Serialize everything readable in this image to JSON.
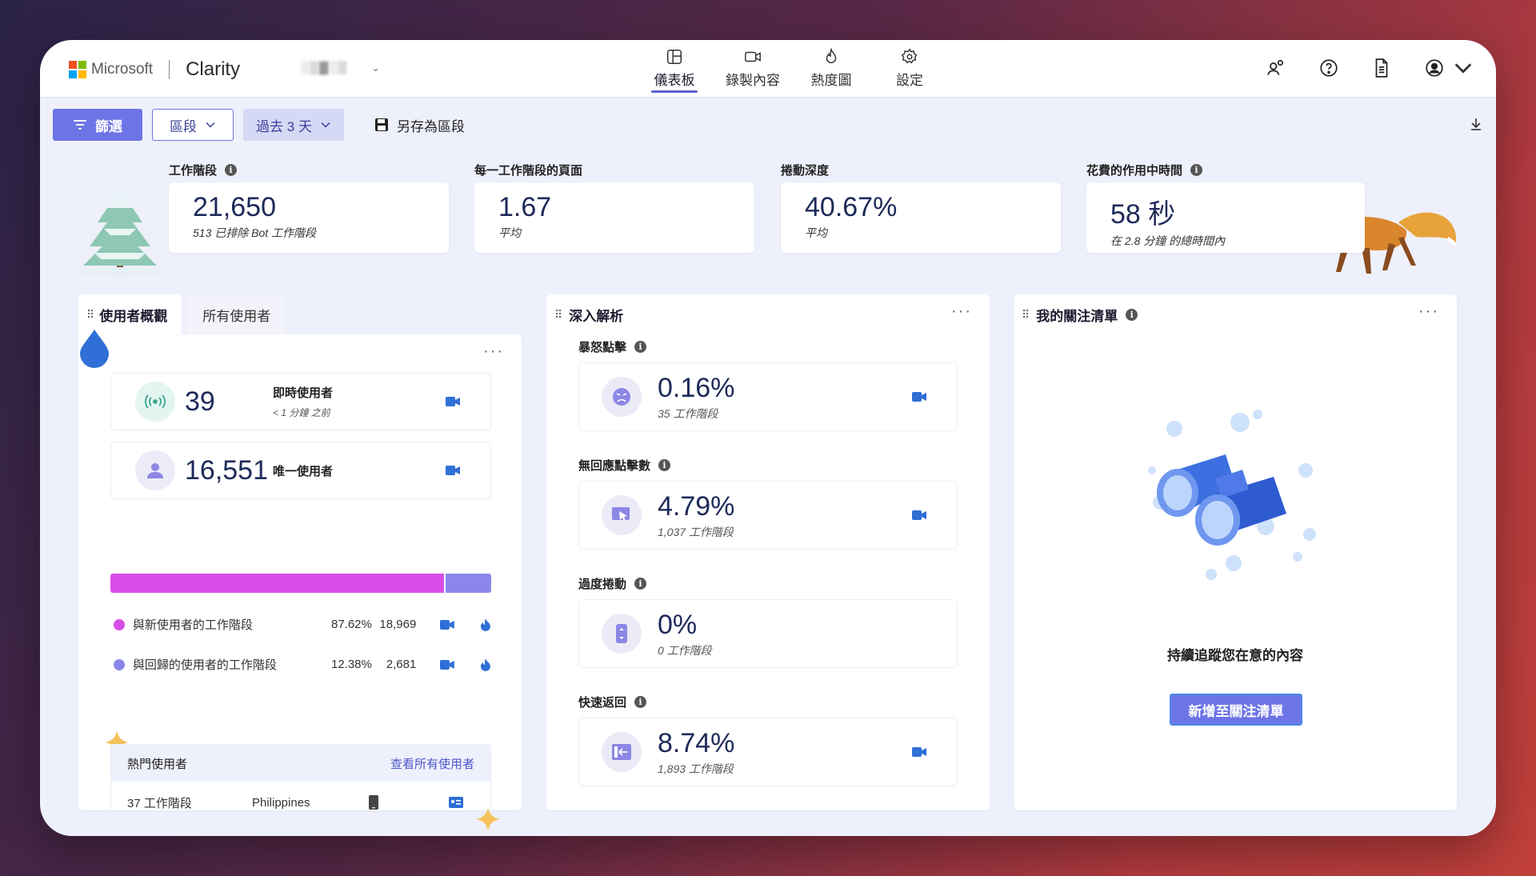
{
  "brand": {
    "company": "Microsoft",
    "app": "Clarity",
    "project": "░▒▓░▒"
  },
  "nav": {
    "tabs": [
      {
        "label": "儀表板",
        "icon": "dashboard-icon",
        "active": true
      },
      {
        "label": "錄製內容",
        "icon": "recordings-icon",
        "active": false
      },
      {
        "label": "熱度圖",
        "icon": "heatmaps-icon",
        "active": false
      },
      {
        "label": "設定",
        "icon": "settings-icon",
        "active": false
      }
    ]
  },
  "filterbar": {
    "filter_label": "篩選",
    "segment_label": "區段",
    "range_label": "過去 3 天",
    "save_label": "另存為區段"
  },
  "kpis": [
    {
      "label": "工作階段",
      "value": "21,650",
      "sub": "513 已排除 Bot 工作階段",
      "info": true
    },
    {
      "label": "每一工作階段的頁面",
      "value": "1.67",
      "sub": "平均",
      "info": false
    },
    {
      "label": "捲動深度",
      "value": "40.67%",
      "sub": "平均",
      "info": false
    },
    {
      "label": "花費的作用中時間",
      "value": "58 秒",
      "sub": "在 2.8 分鐘 的總時間內",
      "info": true
    }
  ],
  "users_panel": {
    "tabs": [
      "使用者概觀",
      "所有使用者"
    ],
    "live": {
      "value": "39",
      "label": "即時使用者",
      "sub": "< 1 分鐘 之前"
    },
    "unique": {
      "value": "16,551",
      "label": "唯一使用者"
    },
    "split": {
      "new_fraction": 0.8762,
      "colors": {
        "new": "#d84de8",
        "returning": "#8b87ea"
      },
      "rows": [
        {
          "label": "與新使用者的工作階段",
          "pct": "87.62%",
          "count": "18,969"
        },
        {
          "label": "與回歸的使用者的工作階段",
          "pct": "12.38%",
          "count": "2,681"
        }
      ]
    },
    "top_users": {
      "title": "熱門使用者",
      "link": "查看所有使用者",
      "row": {
        "sessions": "37 工作階段",
        "country": "Philippines"
      }
    }
  },
  "insights_panel": {
    "title": "深入解析",
    "metrics": [
      {
        "label": "暴怒點擊",
        "value": "0.16%",
        "sub": "35 工作階段",
        "icon": "angry-face-icon"
      },
      {
        "label": "無回應點擊數",
        "value": "4.79%",
        "sub": "1,037 工作階段",
        "icon": "dead-click-icon"
      },
      {
        "label": "過度捲動",
        "value": "0%",
        "sub": "0 工作階段",
        "icon": "scroll-icon"
      },
      {
        "label": "快速返回",
        "value": "8.74%",
        "sub": "1,893 工作階段",
        "icon": "quick-back-icon"
      }
    ]
  },
  "watchlist_panel": {
    "title": "我的關注清單",
    "message": "持續追蹤您在意的內容",
    "cta": "新增至關注清單"
  },
  "colors": {
    "accent": "#6d74e6",
    "navy": "#1e2a5a",
    "video": "#2f6fd6"
  }
}
